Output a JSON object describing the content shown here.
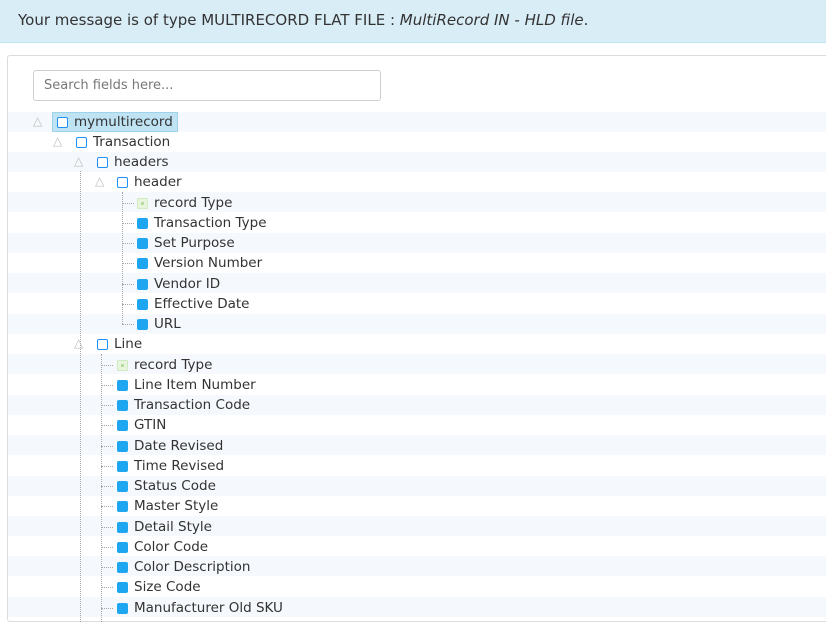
{
  "banner": {
    "prefix": "Your message is of type MULTIRECORD FLAT FILE : ",
    "file_type": "MultiRecord IN - HLD file",
    "suffix": "."
  },
  "search": {
    "placeholder": "Search fields here..."
  },
  "tree": {
    "root": "mymultirecord",
    "transaction": "Transaction",
    "headers": "headers",
    "header": "header",
    "header_fields": [
      "record Type",
      "Transaction Type",
      "Set Purpose",
      "Version Number",
      "Vendor ID",
      "Effective Date",
      "URL"
    ],
    "line": "Line",
    "line_fields": [
      "record Type",
      "Line Item Number",
      "Transaction Code",
      "GTIN",
      "Date Revised",
      "Time Revised",
      "Status Code",
      "Master Style",
      "Detail Style",
      "Color Code",
      "Color Description",
      "Size Code",
      "Manufacturer Old SKU"
    ]
  }
}
